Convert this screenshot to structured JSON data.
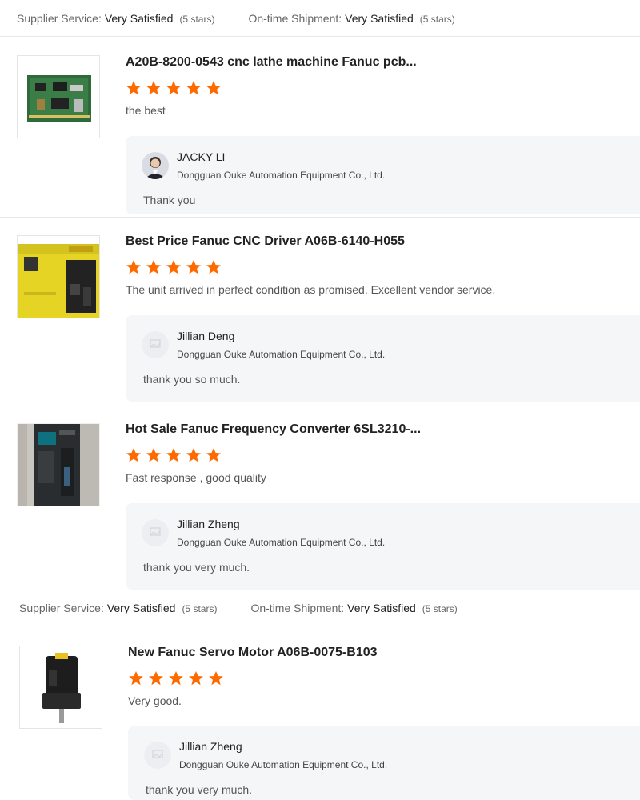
{
  "rating_bars": [
    {
      "supplier_label": "Supplier Service:",
      "supplier_value": "Very Satisfied",
      "supplier_stars": "(5 stars)",
      "shipment_label": "On-time Shipment:",
      "shipment_value": "Very Satisfied",
      "shipment_stars": "(5 stars)"
    },
    {
      "supplier_label": "Supplier Service:",
      "supplier_value": "Very Satisfied",
      "supplier_stars": "(5 stars)",
      "shipment_label": "On-time Shipment:",
      "shipment_value": "Very Satisfied",
      "shipment_stars": "(5 stars)"
    }
  ],
  "star_color": "#ff6a00",
  "reviews": [
    {
      "title": "A20B-8200-0543 cnc lathe machine Fanuc pcb...",
      "rating": 5,
      "comment": "the best",
      "product_image": "green-pcb-board",
      "reply": {
        "name": "JACKY LI",
        "company": "Dongguan Ouke Automation Equipment Co., Ltd.",
        "text": "Thank you",
        "avatar": "person-photo-avatar"
      }
    },
    {
      "title": "Best Price Fanuc CNC Driver A06B-6140-H055",
      "rating": 5,
      "comment": "The unit arrived in perfect condition as promised. Excellent vendor service.",
      "product_image": "yellow-fanuc-drive",
      "reply": {
        "name": "Jillian Deng",
        "company": "Dongguan Ouke Automation Equipment Co., Ltd.",
        "text": "thank you so much.",
        "avatar": "placeholder-avatar"
      }
    },
    {
      "title": "Hot Sale Fanuc Frequency Converter 6SL3210-...",
      "rating": 5,
      "comment": "Fast response , good quality",
      "product_image": "dark-frequency-converter",
      "reply": {
        "name": "Jillian Zheng",
        "company": "Dongguan Ouke Automation Equipment Co., Ltd.",
        "text": "thank you very much.",
        "avatar": "placeholder-avatar"
      }
    },
    {
      "title": "New Fanuc Servo Motor A06B-0075-B103",
      "rating": 5,
      "comment": "Very good.",
      "product_image": "black-servo-motor",
      "reply": {
        "name": "Jillian Zheng",
        "company": "Dongguan Ouke Automation Equipment Co., Ltd.",
        "text": "thank you very much.",
        "avatar": "placeholder-avatar"
      }
    }
  ]
}
